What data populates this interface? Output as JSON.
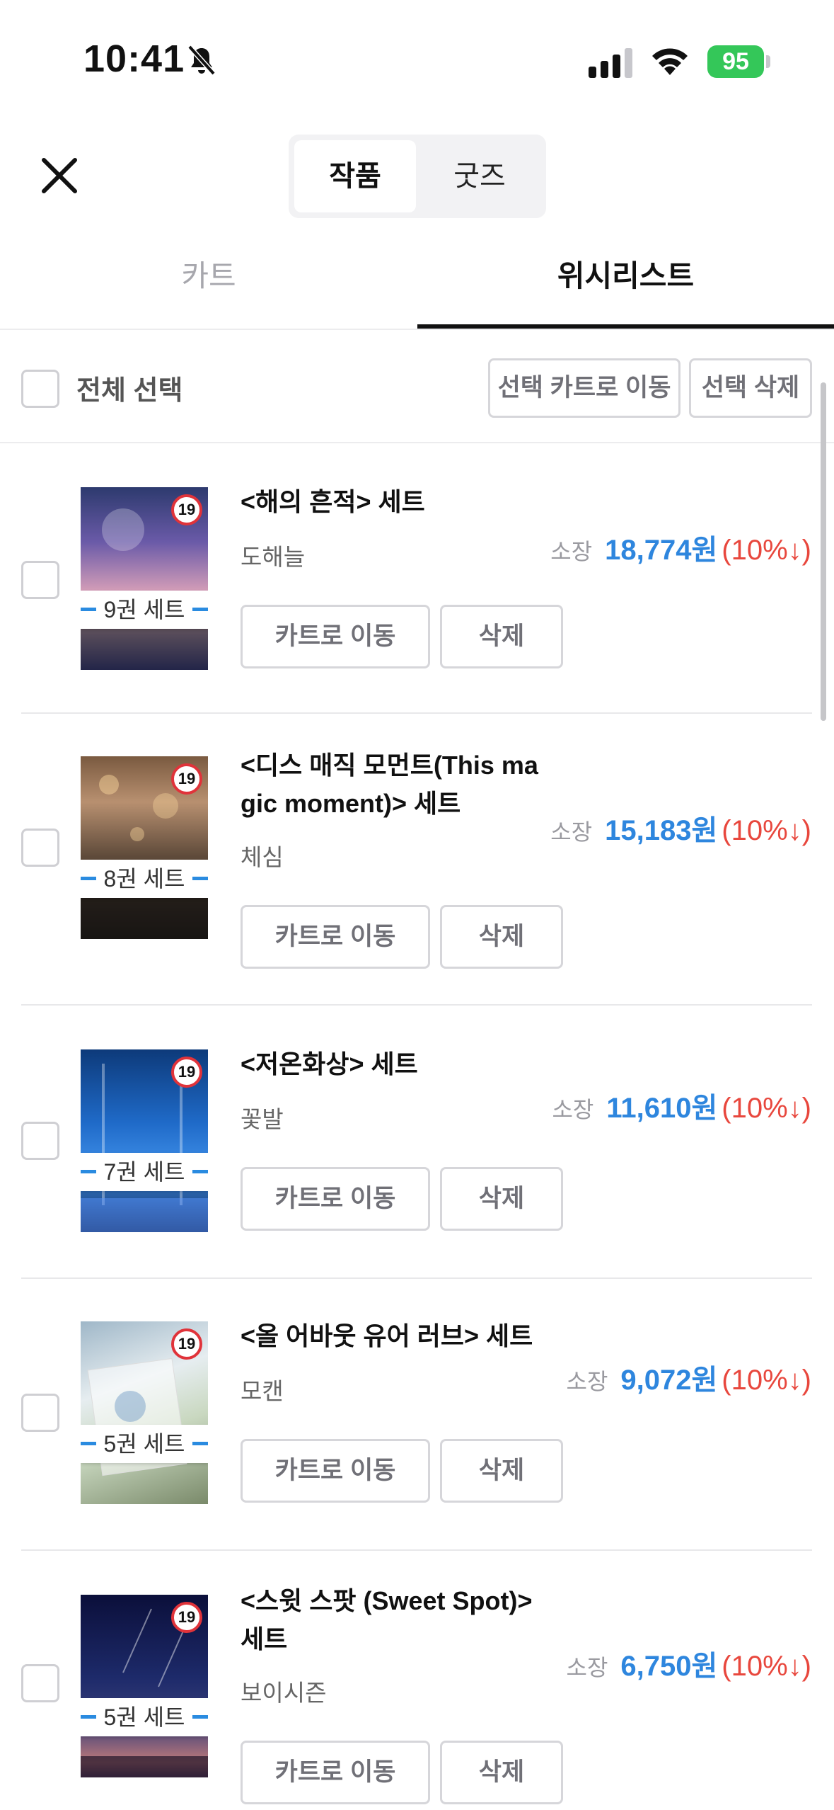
{
  "status_bar": {
    "time": "10:41",
    "battery": "95"
  },
  "header": {
    "segments": [
      "작품",
      "굿즈"
    ],
    "active_segment": "작품"
  },
  "tabs": {
    "cart": "카트",
    "wishlist": "위시리스트",
    "active": "위시리스트"
  },
  "toolbar": {
    "select_all": "전체 선택",
    "move_to_cart": "선택 카트로 이동",
    "delete_selected": "선택 삭제"
  },
  "colors": {
    "price": "#2e86de",
    "discount": "#e8473d",
    "badge_ring": "#e0333a",
    "battery": "#34c759"
  },
  "item_labels": {
    "price_label": "소장",
    "move_btn": "카트로 이동",
    "delete_btn": "삭제",
    "age_badge": "19"
  },
  "items": [
    {
      "title": "<해의 흔적> 세트",
      "author": "도해늘",
      "price": "18,774원",
      "discount": "(10%↓)",
      "set_count": "9권 세트"
    },
    {
      "title": "<디스 매직 모먼트(This ma gic moment)> 세트",
      "author": "체심",
      "price": "15,183원",
      "discount": "(10%↓)",
      "set_count": "8권 세트"
    },
    {
      "title": "<저온화상> 세트",
      "author": "꽃발",
      "price": "11,610원",
      "discount": "(10%↓)",
      "set_count": "7권 세트"
    },
    {
      "title": "<올 어바웃 유어 러브> 세트",
      "author": "모캔",
      "price": "9,072원",
      "discount": "(10%↓)",
      "set_count": "5권 세트"
    },
    {
      "title": "<스윗 스팟 (Sweet Spot)> 세트",
      "author": "보이시즌",
      "price": "6,750원",
      "discount": "(10%↓)",
      "set_count": "5권 세트"
    }
  ]
}
